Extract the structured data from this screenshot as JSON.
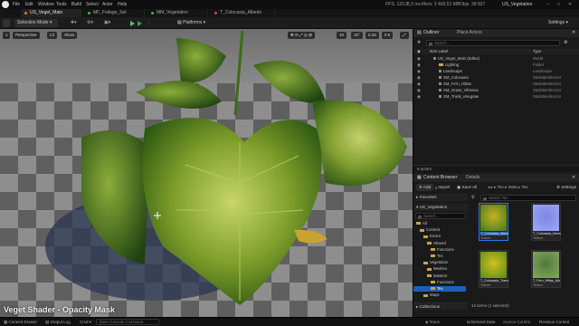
{
  "menubar": {
    "items": [
      "File",
      "Edit",
      "Window",
      "Tools",
      "Build",
      "Select",
      "Actor",
      "Help"
    ],
    "fps": "FPS: 120,0",
    "ms": "8,3 ms",
    "mem": "Mem: 2 460,51 MB",
    "objs": "Objs: 38 837",
    "project": "US_Vegetation"
  },
  "tabs": [
    {
      "label": "US_Veget_Main",
      "color": "#e07a2f"
    },
    {
      "label": "MF_Foliage_Set",
      "color": "#4fb04f"
    },
    {
      "label": "MM_Vegetation",
      "color": "#4fb04f"
    },
    {
      "label": "T_Colocasia_Albedo",
      "color": "#d44"
    }
  ],
  "toolbar": {
    "mode": "Selection Mode",
    "platforms": "Platforms",
    "settings": "Settings"
  },
  "viewport": {
    "perspective": "Perspective",
    "lit": "Lit",
    "show": "Show",
    "snap1": "10",
    "snap2": "10°",
    "snap3": "0.25",
    "snap4": "0.5",
    "caption": "Veget Shader - Opacity Mask"
  },
  "outliner": {
    "tab": "Outliner",
    "tab2": "Place Actors",
    "search_placeholder": "Search...",
    "col_label": "Item Label",
    "col_type": "Type",
    "items": [
      {
        "label": "US_Veget_Main (Editor)",
        "type": "World"
      },
      {
        "label": "Lighting",
        "type": "Folder"
      },
      {
        "label": "Landscape",
        "type": "Landscape"
      },
      {
        "label": "SM_Colocasia",
        "type": "StaticMeshActor"
      },
      {
        "label": "SM_Fern_Hiltas",
        "type": "StaticMeshActor"
      },
      {
        "label": "SM_Grass_VikNova",
        "type": "StaticMeshActor"
      },
      {
        "label": "SM_Trunk_vNegraw",
        "type": "StaticMeshActor"
      }
    ],
    "count": "6 actors"
  },
  "content": {
    "tab": "Content Browser",
    "tab2": "Details",
    "add": "Add",
    "import": "Import",
    "save": "Save All",
    "path": [
      "All",
      "Content",
      "Tex",
      "Mats",
      "Tex"
    ],
    "settings": "Settings",
    "favorites": "Favorites",
    "project": "US_Vegetation",
    "search_placeholder": "Search Tex",
    "tree": [
      {
        "label": "All",
        "d": 0
      },
      {
        "label": "Content",
        "d": 1
      },
      {
        "label": "Enviro",
        "d": 2
      },
      {
        "label": "Shared",
        "d": 3
      },
      {
        "label": "Functions",
        "d": 4
      },
      {
        "label": "Tex",
        "d": 4
      },
      {
        "label": "Vegetation",
        "d": 2
      },
      {
        "label": "Meshes",
        "d": 3
      },
      {
        "label": "Masters",
        "d": 3
      },
      {
        "label": "Functions",
        "d": 4
      },
      {
        "label": "Tex",
        "d": 4
      },
      {
        "label": "Maps",
        "d": 2
      }
    ],
    "assets": [
      {
        "name": "T_Colocasia_Albedo",
        "kind": "Texture",
        "c1": "#c8b020",
        "c2": "#3e7a22",
        "sel": true
      },
      {
        "name": "T_Colocasia_Normal",
        "kind": "Texture",
        "c1": "#7a86e0",
        "c2": "#a0a8ff",
        "sel": false
      },
      {
        "name": "T_Colocasia_Trans",
        "kind": "Texture",
        "c1": "#d0c020",
        "c2": "#5a8a1a",
        "sel": false
      },
      {
        "name": "T_Fern_Hiltas_Alb",
        "kind": "Texture",
        "c1": "#4e7a3a",
        "c2": "#8aa860",
        "sel": false
      }
    ],
    "count": "12 items (1 selected)",
    "collections": "Collections"
  },
  "status": {
    "drawer": "Content Drawer",
    "log": "Output Log",
    "cmd": "Cmd",
    "console_placeholder": "Enter Console Command",
    "trace": "Trace",
    "derived": "Derived Data",
    "source": "Source Control",
    "revision": "Revision Control"
  }
}
